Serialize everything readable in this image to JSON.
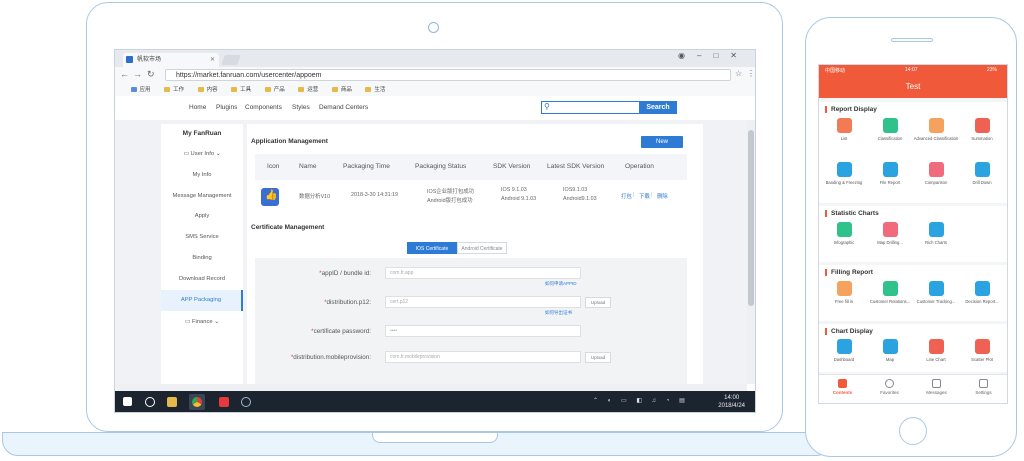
{
  "browser": {
    "tab_title": "帆软市场",
    "url": "https://market.fanruan.com/usercenter/appoem",
    "bookmarks": [
      "应用",
      "工作",
      "内容",
      "工具",
      "产品",
      "运营",
      "商品",
      "生活"
    ]
  },
  "site_nav": {
    "links": [
      "Home",
      "Plugins",
      "Components",
      "Styles",
      "Demand Centers"
    ],
    "search_button": "Search"
  },
  "sidebar": {
    "header": "My FanRuan",
    "items": [
      "User Info",
      "My Info",
      "Message Management",
      "Apply",
      "SMS Service",
      "Binding",
      "Download Record",
      "APP Packaging",
      "Finance"
    ],
    "active": "APP Packaging"
  },
  "app_management": {
    "title": "Application Management",
    "new_button": "New",
    "columns": [
      "Icon",
      "Name",
      "Packaging Time",
      "Packaging Status",
      "SDK Version",
      "Latest SDK Version",
      "Operation"
    ],
    "rows": [
      {
        "name": "数据分析V10",
        "time": "2018-3-30 14:31:19",
        "status": [
          "IOS企业版打包成功",
          "Android版打包成功"
        ],
        "sdk": [
          "IOS 9.1.03",
          "Android 9.1.03"
        ],
        "latest_sdk": [
          "IOS9.1.03",
          "Android9.1.03"
        ],
        "ops": [
          "打包",
          "下载",
          "删除"
        ]
      }
    ]
  },
  "cert_management": {
    "title": "Certificate Management",
    "tabs": [
      "IOS Certificate",
      "Android Certificate"
    ],
    "active_tab": "IOS Certificate",
    "fields": [
      {
        "label": "appID / bundle id:",
        "placeholder": "com.fr.app",
        "hint": "如何申请APPID",
        "upload": ""
      },
      {
        "label": "distribution.p12:",
        "placeholder": "cert.p12",
        "hint": "如何导出证书",
        "upload": "Upload"
      },
      {
        "label": "certificate password:",
        "placeholder": "••••",
        "hint": "",
        "upload": ""
      },
      {
        "label": "distribution.mobileprovision:",
        "placeholder": "com.fr.mobileprovision",
        "hint": "",
        "upload": "Upload"
      }
    ]
  },
  "taskbar": {
    "time": "14:00",
    "date": "2018/4/24"
  },
  "phone": {
    "status_carrier": "中国移动",
    "status_time": "14:07",
    "status_battery": "23%",
    "title": "Test",
    "sections": [
      {
        "title": "Report Display",
        "items": [
          {
            "label": "List",
            "color": "orange"
          },
          {
            "label": "Classification",
            "color": "green"
          },
          {
            "label": "Advanced Classification",
            "color": "peach"
          },
          {
            "label": "Summation",
            "color": "red"
          },
          {
            "label": "Banding & Freezing",
            "color": "blue"
          },
          {
            "label": "File Report",
            "color": "blue"
          },
          {
            "label": "Comparison",
            "color": "pink"
          },
          {
            "label": "Drill Down",
            "color": "blue"
          }
        ]
      },
      {
        "title": "Statistic Charts",
        "items": [
          {
            "label": "Infographic",
            "color": "green"
          },
          {
            "label": "Map Drilling...",
            "color": "pink"
          },
          {
            "label": "Rich Charts",
            "color": "blue"
          }
        ]
      },
      {
        "title": "Filling Report",
        "items": [
          {
            "label": "Free fill in",
            "color": "peach"
          },
          {
            "label": "Customer Relations...",
            "color": "green"
          },
          {
            "label": "Customer Tracking...",
            "color": "blue"
          },
          {
            "label": "Decision Report...",
            "color": "blue"
          }
        ]
      },
      {
        "title": "Chart Display",
        "items": [
          {
            "label": "Dashboard",
            "color": "blue"
          },
          {
            "label": "Map",
            "color": "blue"
          },
          {
            "label": "Line Chart",
            "color": "red"
          },
          {
            "label": "Scatter Plot",
            "color": "red"
          }
        ]
      }
    ],
    "tabbar": [
      "Contents",
      "Favorites",
      "Messages",
      "Settings"
    ],
    "active_tab": "Contents"
  }
}
